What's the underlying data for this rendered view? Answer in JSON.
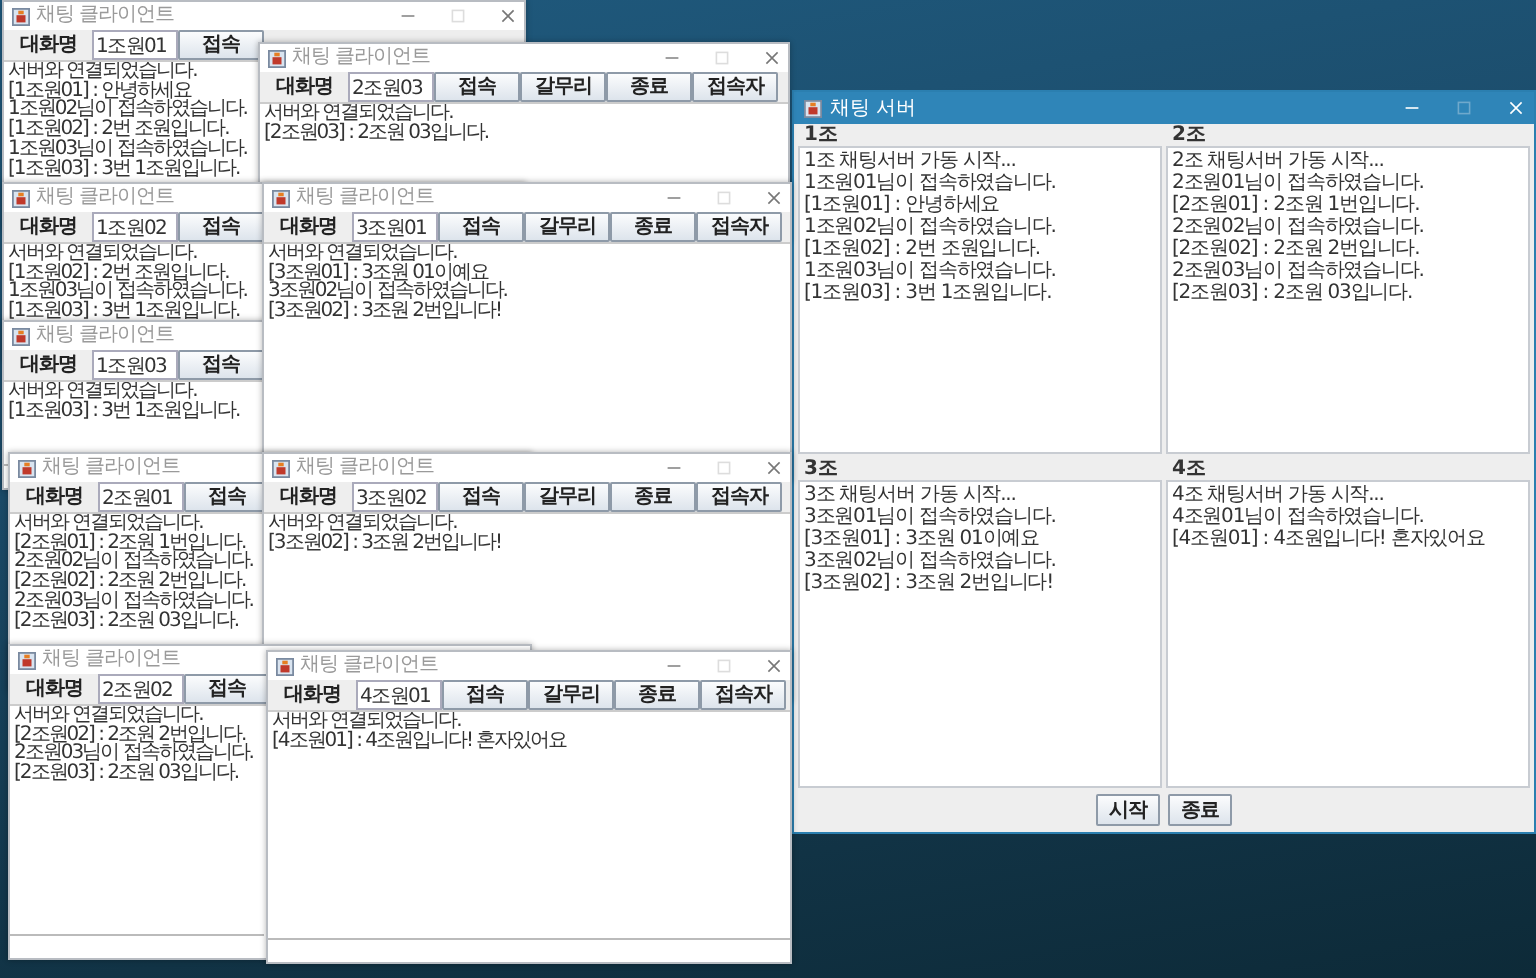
{
  "clients": [
    {
      "title": "채팅 클라이언트",
      "nickname_label": "대화명",
      "nickname": "1조원01",
      "buttons": [
        "접속"
      ],
      "lines": [
        "서버와 연결되었습니다.",
        "[1조원01] : 안녕하세요",
        "1조원02님이 접속하였습니다.",
        "[1조원02] : 2번 조원입니다.",
        "1조원03님이 접속하였습니다.",
        "[1조원03] : 3번 1조원입니다."
      ]
    },
    {
      "title": "채팅 클라이언트",
      "nickname_label": "대화명",
      "nickname": "2조원03",
      "buttons": [
        "접속",
        "갈무리",
        "종료",
        "접속자"
      ],
      "lines": [
        "서버와 연결되었습니다.",
        "[2조원03] : 2조원 03입니다."
      ]
    },
    {
      "title": "채팅 클라이언트",
      "nickname_label": "대화명",
      "nickname": "1조원02",
      "buttons": [
        "접속"
      ],
      "lines": [
        "서버와 연결되었습니다.",
        "[1조원02] : 2번 조원입니다.",
        "1조원03님이 접속하였습니다.",
        "[1조원03] : 3번 1조원입니다."
      ]
    },
    {
      "title": "채팅 클라이언트",
      "nickname_label": "대화명",
      "nickname": "3조원01",
      "buttons": [
        "접속",
        "갈무리",
        "종료",
        "접속자"
      ],
      "lines": [
        "서버와 연결되었습니다.",
        "[3조원01] : 3조원 01이예요",
        "3조원02님이 접속하였습니다.",
        "[3조원02] : 3조원 2번입니다!"
      ]
    },
    {
      "title": "채팅 클라이언트",
      "nickname_label": "대화명",
      "nickname": "1조원03",
      "buttons": [
        "접속"
      ],
      "lines": [
        "서버와 연결되었습니다.",
        "[1조원03] : 3번 1조원입니다."
      ]
    },
    {
      "title": "채팅 클라이언트",
      "nickname_label": "대화명",
      "nickname": "2조원01",
      "buttons": [
        "접속"
      ],
      "lines": [
        "서버와 연결되었습니다.",
        "[2조원01] : 2조원 1번입니다.",
        "2조원02님이 접속하였습니다.",
        "[2조원02] : 2조원 2번입니다.",
        "2조원03님이 접속하였습니다.",
        "[2조원03] : 2조원 03입니다."
      ]
    },
    {
      "title": "채팅 클라이언트",
      "nickname_label": "대화명",
      "nickname": "3조원02",
      "buttons": [
        "접속",
        "갈무리",
        "종료",
        "접속자"
      ],
      "lines": [
        "서버와 연결되었습니다.",
        "[3조원02] : 3조원 2번입니다!"
      ]
    },
    {
      "title": "채팅 클라이언트",
      "nickname_label": "대화명",
      "nickname": "2조원02",
      "buttons": [
        "접속"
      ],
      "lines": [
        "서버와 연결되었습니다.",
        "[2조원02] : 2조원 2번입니다.",
        "2조원03님이 접속하였습니다.",
        "[2조원03] : 2조원 03입니다."
      ]
    },
    {
      "title": "채팅 클라이언트",
      "nickname_label": "대화명",
      "nickname": "4조원01",
      "buttons": [
        "접속",
        "갈무리",
        "종료",
        "접속자"
      ],
      "lines": [
        "서버와 연결되었습니다.",
        "[4조원01] : 4조원입니다! 혼자있어요"
      ]
    }
  ],
  "server": {
    "title": "채팅 서버",
    "panels": [
      {
        "label": "1조",
        "lines": [
          "1조 채팅서버 가동 시작...",
          "1조원01님이 접속하였습니다.",
          "[1조원01] : 안녕하세요",
          "1조원02님이 접속하였습니다.",
          "[1조원02] : 2번 조원입니다.",
          "1조원03님이 접속하였습니다.",
          "[1조원03] : 3번 1조원입니다."
        ]
      },
      {
        "label": "2조",
        "lines": [
          "2조 채팅서버 가동 시작...",
          "2조원01님이 접속하였습니다.",
          "[2조원01] : 2조원 1번입니다.",
          "2조원02님이 접속하였습니다.",
          "[2조원02] : 2조원 2번입니다.",
          "2조원03님이 접속하였습니다.",
          "[2조원03] : 2조원 03입니다."
        ]
      },
      {
        "label": "3조",
        "lines": [
          "3조 채팅서버 가동 시작...",
          "3조원01님이 접속하였습니다.",
          "[3조원01] : 3조원 01이예요",
          "3조원02님이 접속하였습니다.",
          "[3조원02] : 3조원 2번입니다!"
        ]
      },
      {
        "label": "4조",
        "lines": [
          "4조 채팅서버 가동 시작...",
          "4조원01님이 접속하였습니다.",
          "[4조원01] : 4조원입니다! 혼자있어요"
        ]
      }
    ],
    "buttons": [
      "시작",
      "종료"
    ]
  }
}
